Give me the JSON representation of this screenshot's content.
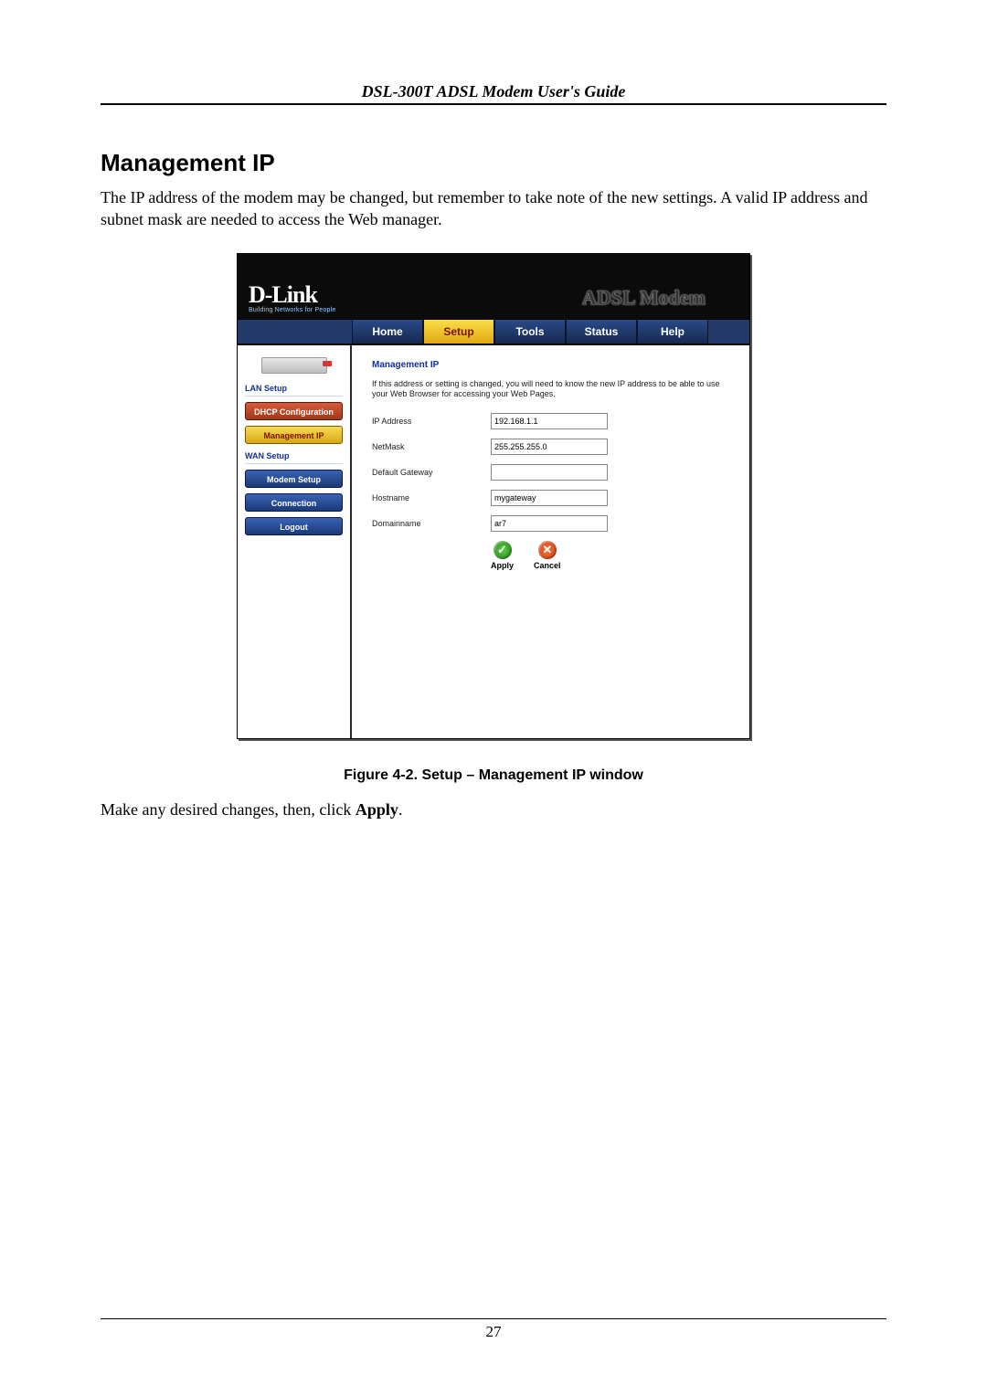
{
  "header": {
    "title": "DSL-300T ADSL Modem User's Guide"
  },
  "section": {
    "heading": "Management IP",
    "intro": "The IP address of the modem may be changed, but remember to take note of the new settings. A valid IP address and subnet mask are needed to access the Web manager."
  },
  "modem": {
    "brand": "D-Link",
    "brand_tag": "Building Networks for People",
    "product": "ADSL Modem",
    "tabs": [
      "Home",
      "Setup",
      "Tools",
      "Status",
      "Help"
    ],
    "active_tab": "Setup",
    "sidebar": {
      "group1": "LAN Setup",
      "group2": "WAN Setup",
      "dhcp": "DHCP Configuration",
      "mgmt": "Management IP",
      "modem_setup": "Modem Setup",
      "connection": "Connection",
      "logout": "Logout"
    },
    "panel": {
      "title": "Management IP",
      "note": "If this address or setting is changed, you will need to know the new IP address to be able to use your Web Browser for accessing your Web Pages.",
      "fields": {
        "ip_label": "IP Address",
        "ip_value": "192.168.1.1",
        "netmask_label": "NetMask",
        "netmask_value": "255.255.255.0",
        "gateway_label": "Default Gateway",
        "gateway_value": "",
        "host_label": "Hostname",
        "host_value": "mygateway",
        "domain_label": "Domainname",
        "domain_value": "ar7"
      },
      "apply": "Apply",
      "cancel": "Cancel"
    }
  },
  "caption": "Figure 4-2. Setup – Management IP window",
  "follow": {
    "pre": "Make any desired changes, then, click ",
    "bold": "Apply",
    "post": "."
  },
  "page_number": "27"
}
